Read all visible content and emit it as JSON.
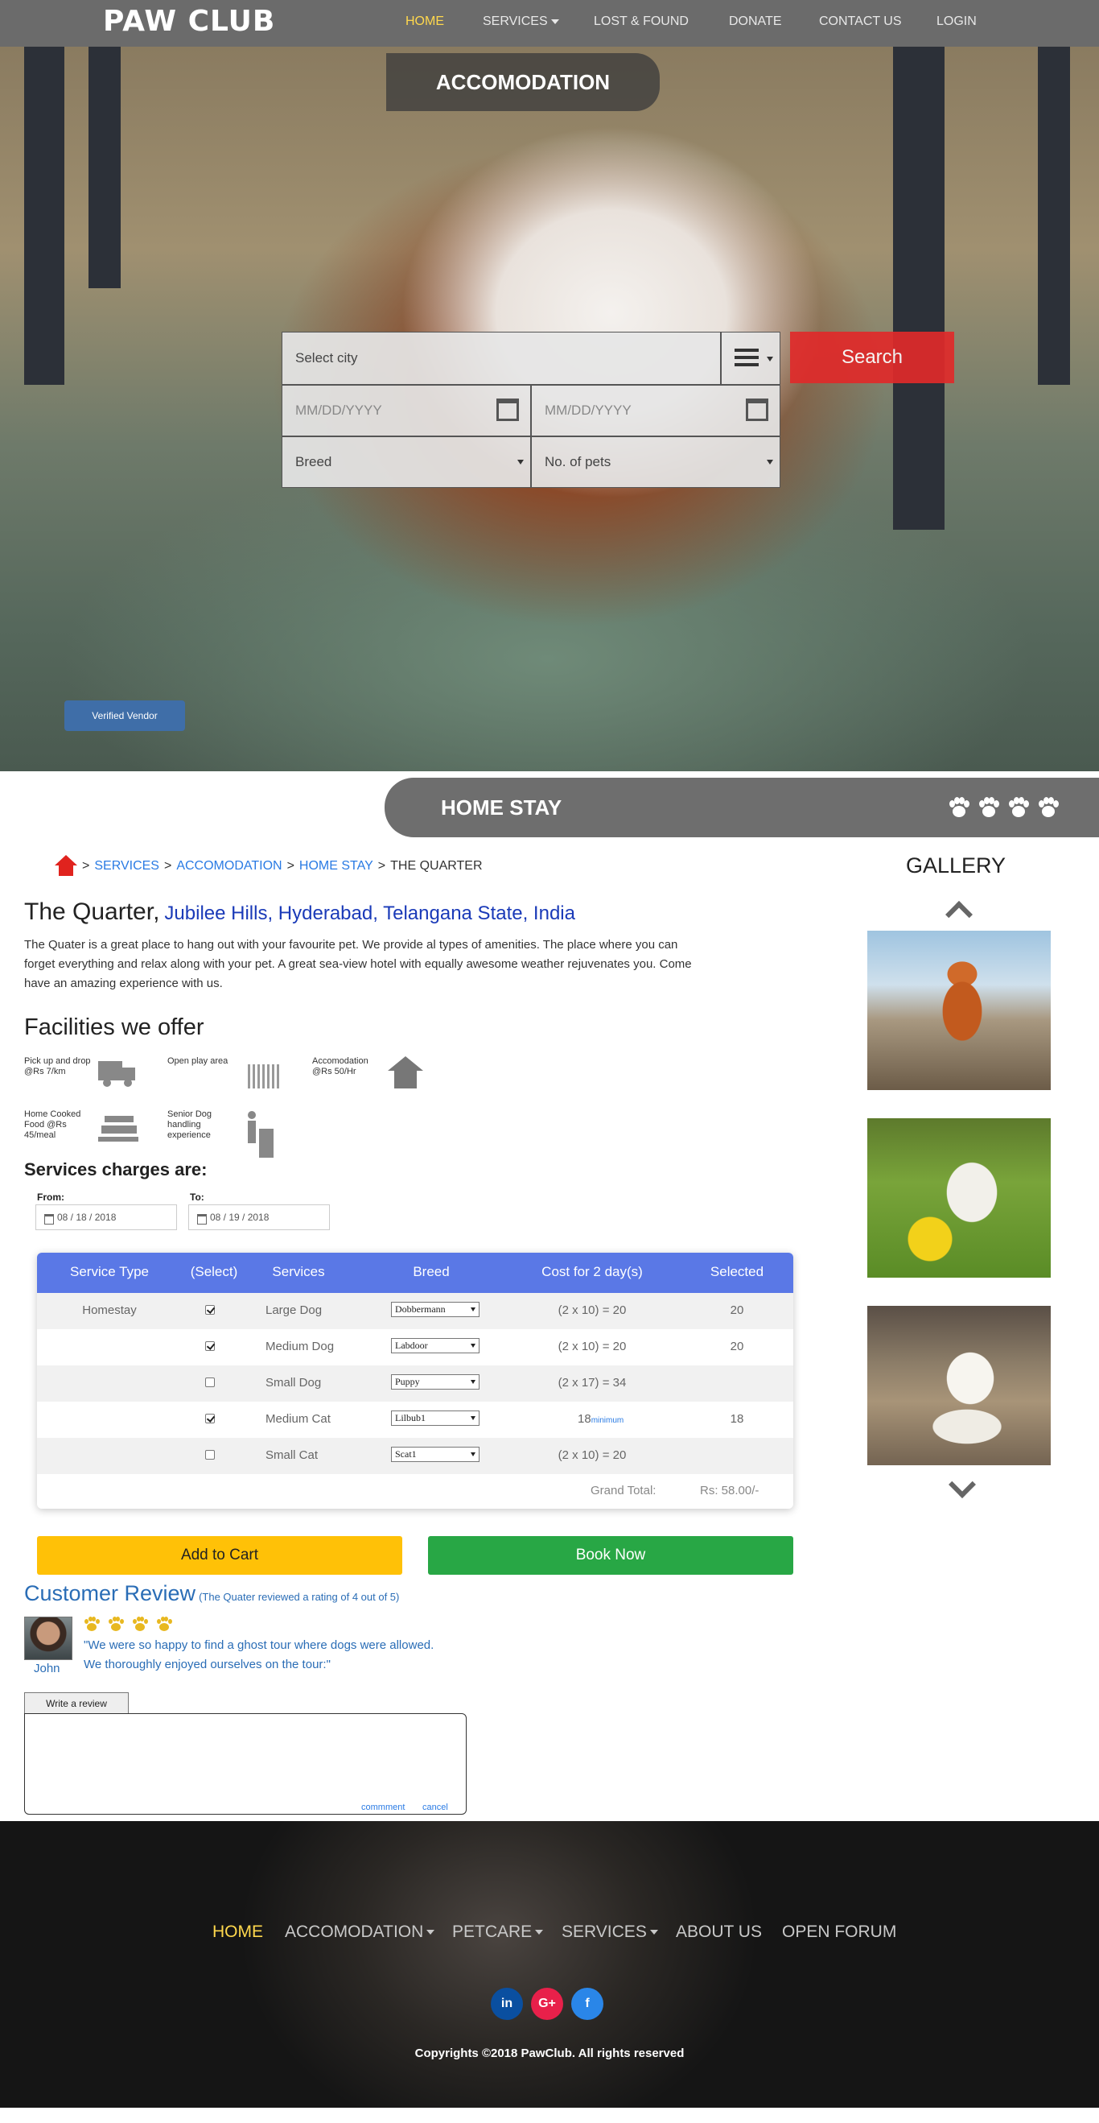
{
  "nav": {
    "logo": "PAW CLUB",
    "items": [
      "HOME",
      "SERVICES",
      "LOST & FOUND",
      "DONATE",
      "CONTACT US",
      "LOGIN"
    ],
    "active": "HOME"
  },
  "hero": {
    "title": "ACCOMODATION",
    "city_placeholder": "Select city",
    "date_from_placeholder": "MM/DD/YYYY",
    "date_to_placeholder": "MM/DD/YYYY",
    "breed_label": "Breed",
    "pets_label": "No. of pets",
    "search_label": "Search",
    "verified_label": "Verified Vendor"
  },
  "homestay_bar": {
    "title": "HOME STAY",
    "paw_count": 4
  },
  "breadcrumb": {
    "items": [
      "SERVICES",
      "ACCOMODATION",
      "HOME STAY"
    ],
    "current": "THE QUARTER",
    "sep": ">"
  },
  "listing": {
    "name": "The Quarter,",
    "location": "Jubilee Hills, Hyderabad, Telangana State, India",
    "description": "The Quater is a great place to hang out with your favourite pet. We provide al types of amenities. The place where you can forget everything and relax along with your pet. A great sea-view hotel with equally awesome weather rejuvenates you. Come have an amazing experience with us."
  },
  "facilities": {
    "title": "Facilities we offer",
    "items": [
      {
        "label": "Pick up and drop @Rs 7/km",
        "icon": "truck-icon"
      },
      {
        "label": "Open play area",
        "icon": "grass-icon"
      },
      {
        "label": "Accomodation @Rs 50/Hr",
        "icon": "house-icon"
      },
      {
        "label": "Home Cooked Food @Rs 45/meal",
        "icon": "food-icon"
      },
      {
        "label": "Senior Dog handling experience",
        "icon": "dog-walker-icon"
      }
    ]
  },
  "charges": {
    "title": "Services charges are:",
    "from_label": "From:",
    "to_label": "To:",
    "from_value": "08 / 18 / 2018",
    "to_value": "08 / 19 / 2018"
  },
  "table": {
    "headers": [
      "Service Type",
      "(Select)",
      "Services",
      "Breed",
      "Cost for 2 day(s)",
      "Selected"
    ],
    "rows": [
      {
        "type": "Homestay",
        "checked": true,
        "service": "Large Dog",
        "breed": "Dobbermann",
        "cost": "(2 x 10) = 20",
        "selected": "20"
      },
      {
        "type": "",
        "checked": true,
        "service": "Medium Dog",
        "breed": "Labdoor",
        "cost": "(2 x 10) = 20",
        "selected": "20"
      },
      {
        "type": "",
        "checked": false,
        "service": "Small Dog",
        "breed": "Puppy",
        "cost": "(2 x 17) = 34",
        "selected": ""
      },
      {
        "type": "",
        "checked": true,
        "service": "Medium Cat",
        "breed": "Lilbub1",
        "cost": "18",
        "cost_note": "minimum",
        "selected": "18"
      },
      {
        "type": "",
        "checked": false,
        "service": "Small Cat",
        "breed": "Scat1",
        "cost": "(2 x 10) = 20",
        "selected": ""
      }
    ],
    "total_label": "Grand Total:",
    "total_value": "Rs: 58.00/-"
  },
  "actions": {
    "cart": "Add to Cart",
    "book": "Book Now"
  },
  "review": {
    "title": "Customer Review",
    "subtitle": "(The Quater reviewed a rating of 4 out of 5)",
    "reviewer": "John",
    "rating": 4,
    "text_line1": "\"We were so happy to find a ghost tour where dogs were allowed.",
    "text_line2": "We thoroughly enjoyed ourselves on the tour:\"",
    "write_tab": "Write a review",
    "comment_link": "commment",
    "cancel_link": "cancel"
  },
  "gallery": {
    "title": "GALLERY"
  },
  "footer": {
    "nav": [
      "HOME",
      "ACCOMODATION",
      "PETCARE",
      "SERVICES",
      "ABOUT US",
      "OPEN FORUM"
    ],
    "social": [
      "in",
      "G+",
      "f"
    ],
    "copyright": "Copyrights ©2018 PawClub. All rights reserved"
  },
  "colors": {
    "nav_bg": "#6b6b6b",
    "active_nav": "#ffd84d",
    "search": "#e02a2a",
    "table_header": "#5a78e6",
    "cart": "#ffc107",
    "book": "#28a745",
    "linkedin": "#0a4fa0",
    "google": "#e8204a",
    "facebook": "#2a86e8"
  }
}
